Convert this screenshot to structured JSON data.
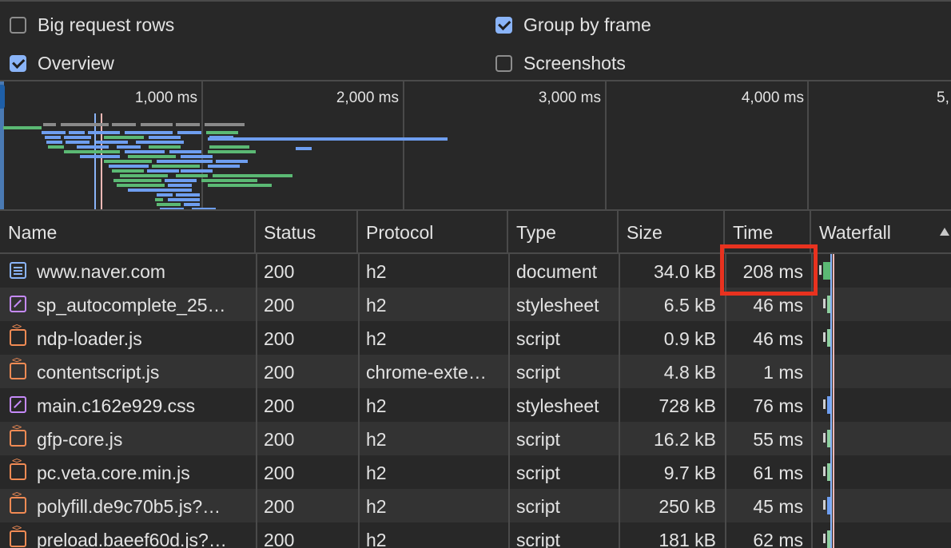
{
  "settings": {
    "big_request_rows": {
      "label": "Big request rows",
      "checked": false
    },
    "group_by_frame": {
      "label": "Group by frame",
      "checked": true
    },
    "overview": {
      "label": "Overview",
      "checked": true
    },
    "screenshots": {
      "label": "Screenshots",
      "checked": false
    }
  },
  "overview_ticks": [
    "1,000 ms",
    "2,000 ms",
    "3,000 ms",
    "4,000 ms",
    "5,"
  ],
  "columns": {
    "name": "Name",
    "status": "Status",
    "protocol": "Protocol",
    "type": "Type",
    "size": "Size",
    "time": "Time",
    "waterfall": "Waterfall"
  },
  "sort_icon": "sort-ascending-icon",
  "colors": {
    "background": "#282828",
    "row_alt": "#333333",
    "highlight": "#e8321f",
    "document": "#8ab4f8",
    "stylesheet": "#c58af9",
    "script": "#f28b54",
    "bar_green": "#5bb974",
    "bar_blue": "#6e9ef0",
    "bar_gray": "#8a8a8a"
  },
  "requests": [
    {
      "name": "www.naver.com",
      "icon": "document-icon",
      "kind": "doc",
      "status": "200",
      "protocol": "h2",
      "type": "document",
      "size": "34.0 kB",
      "time": "208 ms"
    },
    {
      "name": "sp_autocomplete_25…",
      "icon": "stylesheet-icon",
      "kind": "css",
      "status": "200",
      "protocol": "h2",
      "type": "stylesheet",
      "size": "6.5 kB",
      "time": "46 ms"
    },
    {
      "name": "ndp-loader.js",
      "icon": "script-icon",
      "kind": "js",
      "status": "200",
      "protocol": "h2",
      "type": "script",
      "size": "0.9 kB",
      "time": "46 ms"
    },
    {
      "name": "contentscript.js",
      "icon": "script-icon",
      "kind": "js",
      "status": "200",
      "protocol": "chrome-exte…",
      "type": "script",
      "size": "4.8 kB",
      "time": "1 ms"
    },
    {
      "name": "main.c162e929.css",
      "icon": "stylesheet-icon",
      "kind": "css",
      "status": "200",
      "protocol": "h2",
      "type": "stylesheet",
      "size": "728 kB",
      "time": "76 ms"
    },
    {
      "name": "gfp-core.js",
      "icon": "script-icon",
      "kind": "js",
      "status": "200",
      "protocol": "h2",
      "type": "script",
      "size": "16.2 kB",
      "time": "55 ms"
    },
    {
      "name": "pc.veta.core.min.js",
      "icon": "script-icon",
      "kind": "js",
      "status": "200",
      "protocol": "h2",
      "type": "script",
      "size": "9.7 kB",
      "time": "61 ms"
    },
    {
      "name": "polyfill.de9c70b5.js?…",
      "icon": "script-icon",
      "kind": "js",
      "status": "200",
      "protocol": "h2",
      "type": "script",
      "size": "250 kB",
      "time": "45 ms"
    },
    {
      "name": "preload.baeef60d.js?…",
      "icon": "script-icon",
      "kind": "js",
      "status": "200",
      "protocol": "h2",
      "type": "script",
      "size": "181 kB",
      "time": "62 ms"
    }
  ]
}
